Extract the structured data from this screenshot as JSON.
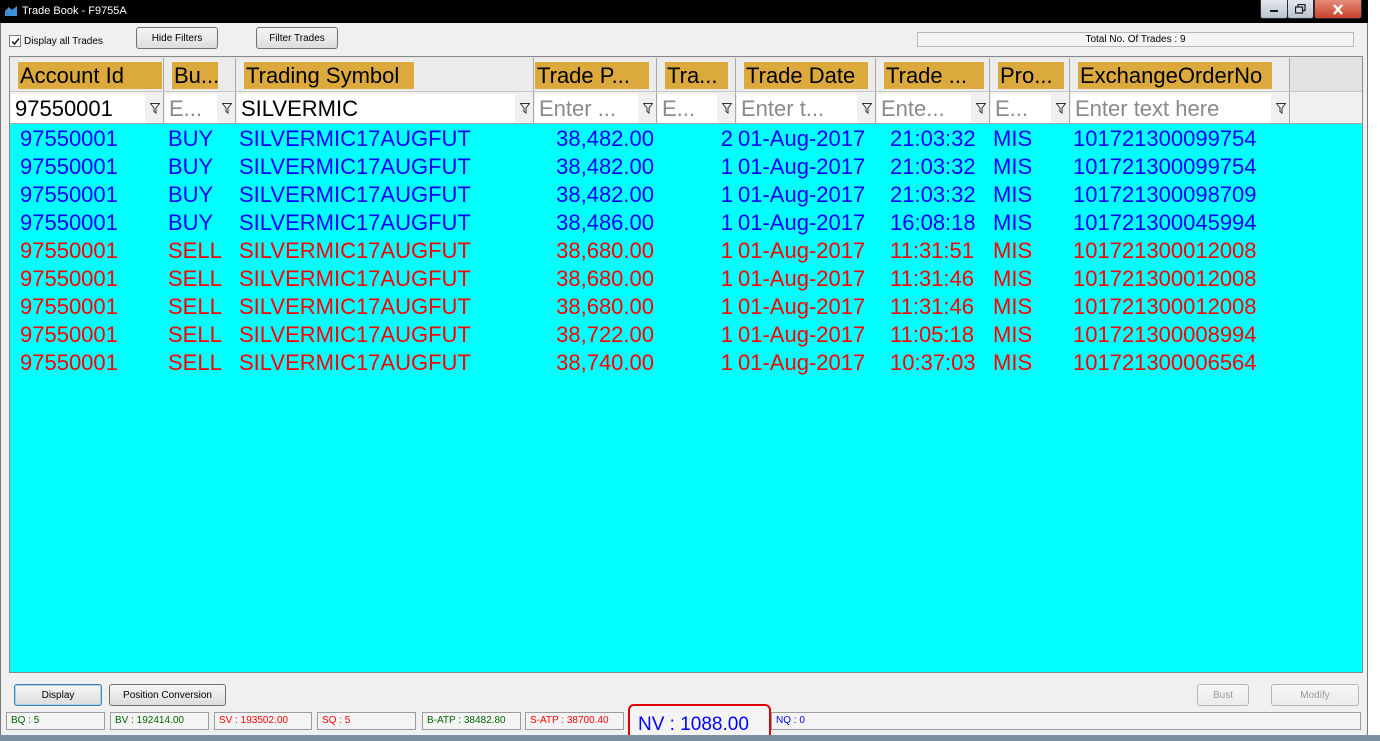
{
  "window": {
    "title": "Trade Book - F9755A"
  },
  "toolbar": {
    "display_all_label": "Display all Trades",
    "display_all_checked": true,
    "hide_filters_label": "Hide Filters",
    "filter_trades_label": "Filter Trades",
    "total_trades_label": "Total No. Of Trades : 9"
  },
  "columns": [
    {
      "key": "account",
      "label": "Account Id",
      "filter_value": "97550001",
      "placeholder": ""
    },
    {
      "key": "side",
      "label": "Bu...",
      "filter_value": "",
      "placeholder": "E..."
    },
    {
      "key": "symbol",
      "label": "Trading Symbol",
      "filter_value": "SILVERMIC",
      "placeholder": ""
    },
    {
      "key": "price",
      "label": "Trade P...",
      "filter_value": "",
      "placeholder": "Enter ..."
    },
    {
      "key": "qty",
      "label": "Tra...",
      "filter_value": "",
      "placeholder": "E..."
    },
    {
      "key": "date",
      "label": "Trade Date",
      "filter_value": "",
      "placeholder": "Enter t..."
    },
    {
      "key": "time",
      "label": "Trade ...",
      "filter_value": "",
      "placeholder": "Ente..."
    },
    {
      "key": "product",
      "label": "Pro...",
      "filter_value": "",
      "placeholder": "E..."
    },
    {
      "key": "exchange_order",
      "label": "ExchangeOrderNo",
      "filter_value": "",
      "placeholder": "Enter text here"
    }
  ],
  "trades": [
    {
      "account": "97550001",
      "side": "BUY",
      "symbol": "SILVERMIC17AUGFUT",
      "price": "38,482.00",
      "qty": "2",
      "date": "01-Aug-2017",
      "time": "21:03:32",
      "product": "MIS",
      "exchange_order": "101721300099754"
    },
    {
      "account": "97550001",
      "side": "BUY",
      "symbol": "SILVERMIC17AUGFUT",
      "price": "38,482.00",
      "qty": "1",
      "date": "01-Aug-2017",
      "time": "21:03:32",
      "product": "MIS",
      "exchange_order": "101721300099754"
    },
    {
      "account": "97550001",
      "side": "BUY",
      "symbol": "SILVERMIC17AUGFUT",
      "price": "38,482.00",
      "qty": "1",
      "date": "01-Aug-2017",
      "time": "21:03:32",
      "product": "MIS",
      "exchange_order": "101721300098709"
    },
    {
      "account": "97550001",
      "side": "BUY",
      "symbol": "SILVERMIC17AUGFUT",
      "price": "38,486.00",
      "qty": "1",
      "date": "01-Aug-2017",
      "time": "16:08:18",
      "product": "MIS",
      "exchange_order": "101721300045994"
    },
    {
      "account": "97550001",
      "side": "SELL",
      "symbol": "SILVERMIC17AUGFUT",
      "price": "38,680.00",
      "qty": "1",
      "date": "01-Aug-2017",
      "time": "11:31:51",
      "product": "MIS",
      "exchange_order": "101721300012008"
    },
    {
      "account": "97550001",
      "side": "SELL",
      "symbol": "SILVERMIC17AUGFUT",
      "price": "38,680.00",
      "qty": "1",
      "date": "01-Aug-2017",
      "time": "11:31:46",
      "product": "MIS",
      "exchange_order": "101721300012008"
    },
    {
      "account": "97550001",
      "side": "SELL",
      "symbol": "SILVERMIC17AUGFUT",
      "price": "38,680.00",
      "qty": "1",
      "date": "01-Aug-2017",
      "time": "11:31:46",
      "product": "MIS",
      "exchange_order": "101721300012008"
    },
    {
      "account": "97550001",
      "side": "SELL",
      "symbol": "SILVERMIC17AUGFUT",
      "price": "38,722.00",
      "qty": "1",
      "date": "01-Aug-2017",
      "time": "11:05:18",
      "product": "MIS",
      "exchange_order": "101721300008994"
    },
    {
      "account": "97550001",
      "side": "SELL",
      "symbol": "SILVERMIC17AUGFUT",
      "price": "38,740.00",
      "qty": "1",
      "date": "01-Aug-2017",
      "time": "10:37:03",
      "product": "MIS",
      "exchange_order": "101721300006564"
    }
  ],
  "footer_buttons": {
    "display_label": "Display",
    "position_conversion_label": "Position Conversion",
    "bust_label": "Bust",
    "modify_label": "Modify"
  },
  "status": {
    "bq": "BQ : 5",
    "bv": "BV : 192414.00",
    "sv": "SV : 193502.00",
    "sq": "SQ : 5",
    "batp": "B-ATP : 38482.80",
    "satp": "S-ATP : 38700.40",
    "nv": "NV : 1088.00",
    "nq": "NQ : 0"
  },
  "colors": {
    "grid_background": "#00ffff",
    "header_label": "#dcaa3c",
    "buy_text": "#0000ff",
    "sell_text": "#ff0000",
    "highlight_box": "#e10000"
  }
}
